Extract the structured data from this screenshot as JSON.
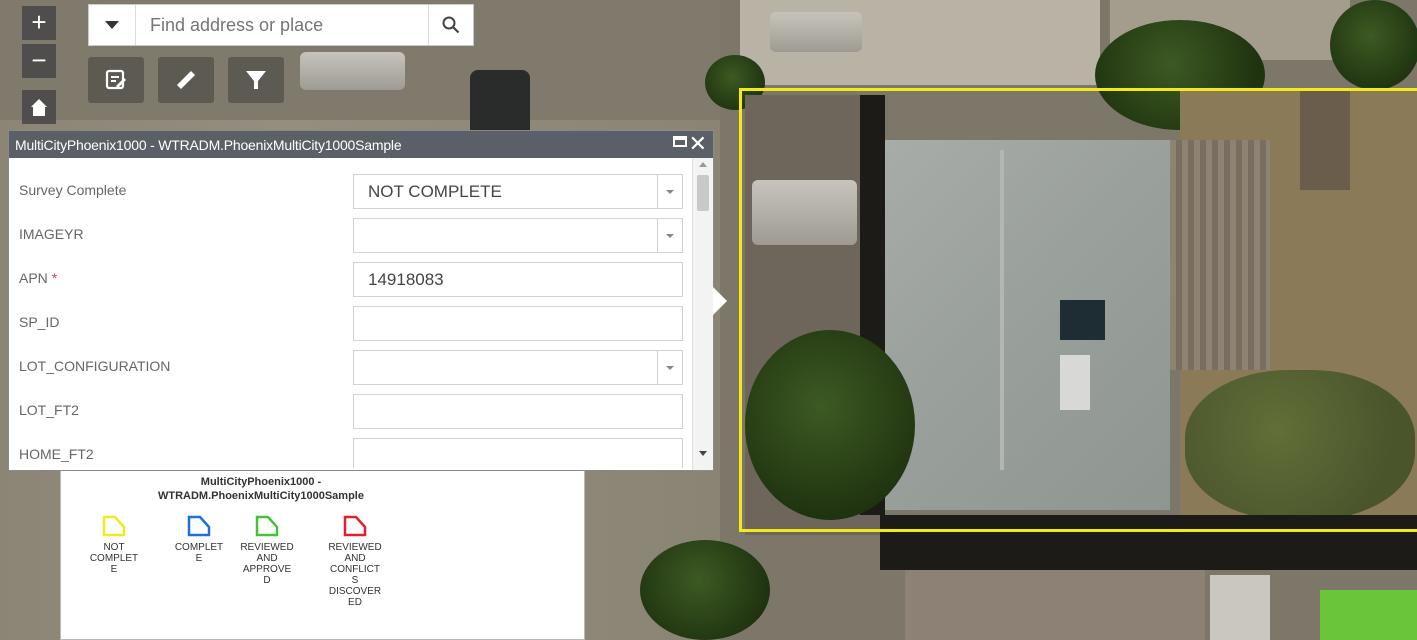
{
  "search": {
    "placeholder": "Find address or place"
  },
  "map_controls": {
    "zoom_in": "+",
    "zoom_out": "−"
  },
  "popup": {
    "title": "MultiCityPhoenix1000 - WTRADM.PhoenixMultiCity1000Sample",
    "close_glyph": "✕",
    "fields": [
      {
        "label": "Survey Complete",
        "value": "NOT COMPLETE",
        "required": false,
        "dropdown": true
      },
      {
        "label": "IMAGEYR",
        "value": "",
        "required": false,
        "dropdown": true
      },
      {
        "label": "APN",
        "value": "14918083",
        "required": true,
        "dropdown": false
      },
      {
        "label": "SP_ID",
        "value": "",
        "required": false,
        "dropdown": false
      },
      {
        "label": "LOT_CONFIGURATION",
        "value": "",
        "required": false,
        "dropdown": true
      },
      {
        "label": "LOT_FT2",
        "value": "",
        "required": false,
        "dropdown": false
      },
      {
        "label": "HOME_FT2",
        "value": "",
        "required": false,
        "dropdown": false
      }
    ]
  },
  "legend": {
    "title_line1": "MultiCityPhoenix1000 -",
    "title_line2": "WTRADM.PhoenixMultiCity1000Sample",
    "items": [
      {
        "label": "NOT\nCOMPLET\nE",
        "color": "#f3ea1a"
      },
      {
        "label": "COMPLET\nE",
        "color": "#1f6fe0"
      },
      {
        "label": "REVIEWED\nAND\nAPPROVE\nD",
        "color": "#45c23a"
      },
      {
        "label": "REVIEWED\nAND\nCONFLICT\nS\nDISCOVER\nED",
        "color": "#e0202a"
      }
    ]
  },
  "selection_outline_color": "#f3ea1a",
  "icons": {
    "search": "search-icon",
    "edit": "edit-icon",
    "measure": "ruler-icon",
    "filter": "filter-icon",
    "home": "home-icon"
  }
}
